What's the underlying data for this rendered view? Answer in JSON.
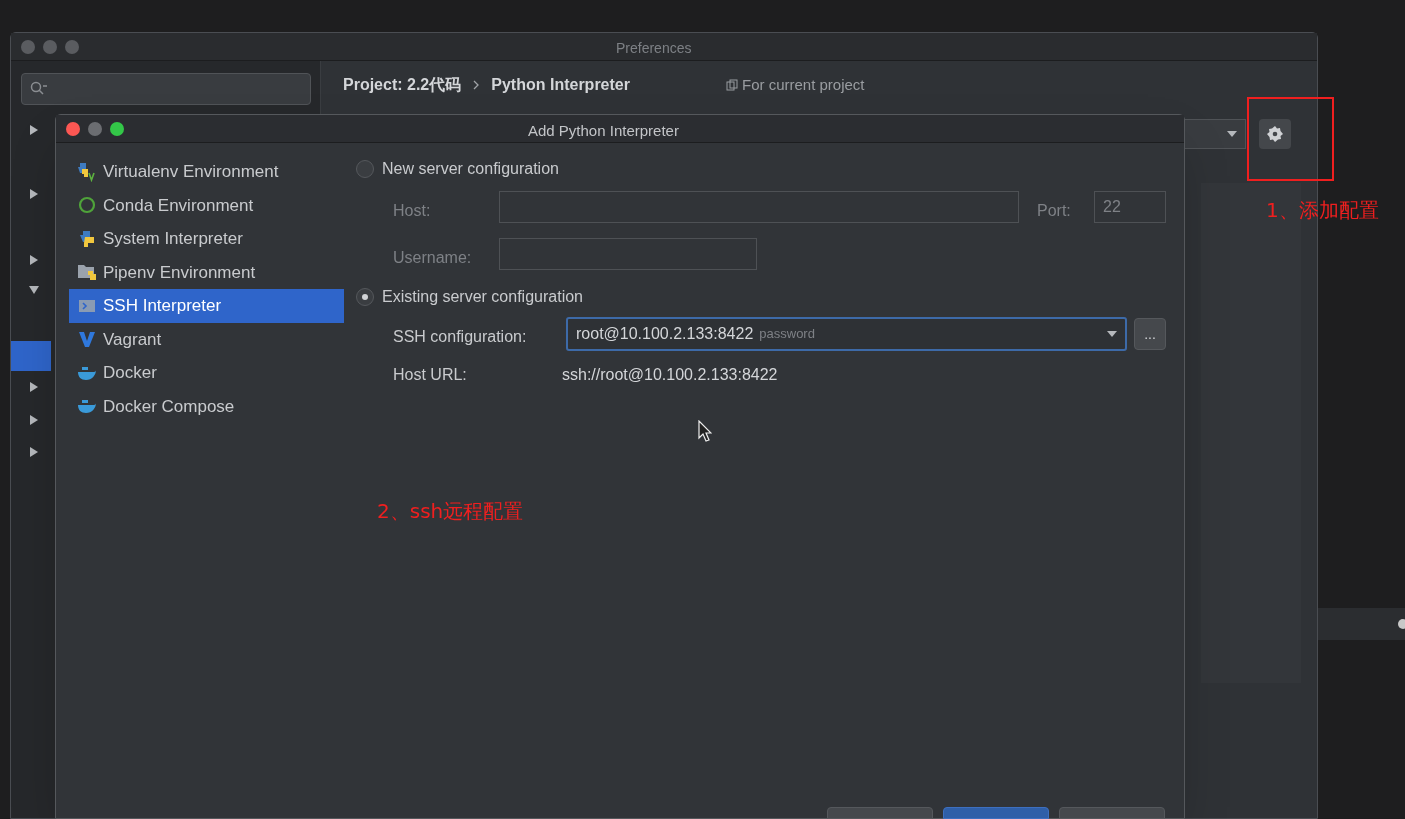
{
  "preferences": {
    "title": "Preferences",
    "breadcrumb": [
      {
        "text": "Project: 2.2代码"
      },
      {
        "text": "Python Interpreter"
      }
    ],
    "scope": "For current project",
    "tree_arrows": [
      {
        "expanded": false
      },
      {
        "expanded": false
      },
      {
        "expanded": false
      },
      {
        "expanded": true
      },
      {
        "expanded": false
      },
      {
        "expanded": false
      },
      {
        "expanded": false
      }
    ]
  },
  "dialog": {
    "title": "Add Python Interpreter",
    "types": [
      {
        "label": "Virtualenv Environment",
        "selected": false
      },
      {
        "label": "Conda Environment",
        "selected": false
      },
      {
        "label": "System Interpreter",
        "selected": false
      },
      {
        "label": "Pipenv Environment",
        "selected": false
      },
      {
        "label": "SSH Interpreter",
        "selected": true
      },
      {
        "label": "Vagrant",
        "selected": false
      },
      {
        "label": "Docker",
        "selected": false
      },
      {
        "label": "Docker Compose",
        "selected": false
      }
    ],
    "new_server": {
      "label": "New server configuration",
      "selected": false,
      "host_label": "Host:",
      "port_label": "Port:",
      "port": "22",
      "username_label": "Username:"
    },
    "existing_server": {
      "label": "Existing server configuration",
      "selected": true,
      "ssh_label": "SSH configuration:",
      "ssh_value": "root@10.100.2.133:8422",
      "ssh_auth": "password",
      "browse": "...",
      "host_url_label": "Host URL:",
      "host_url": "ssh://root@10.100.2.133:8422"
    },
    "buttons": [
      {
        "kind": "plain"
      },
      {
        "kind": "primary"
      },
      {
        "kind": "plain"
      }
    ]
  },
  "annotations": [
    {
      "text": "1、添加配置",
      "boxed": true
    },
    {
      "text": "2、ssh远程配置",
      "boxed": false
    }
  ]
}
